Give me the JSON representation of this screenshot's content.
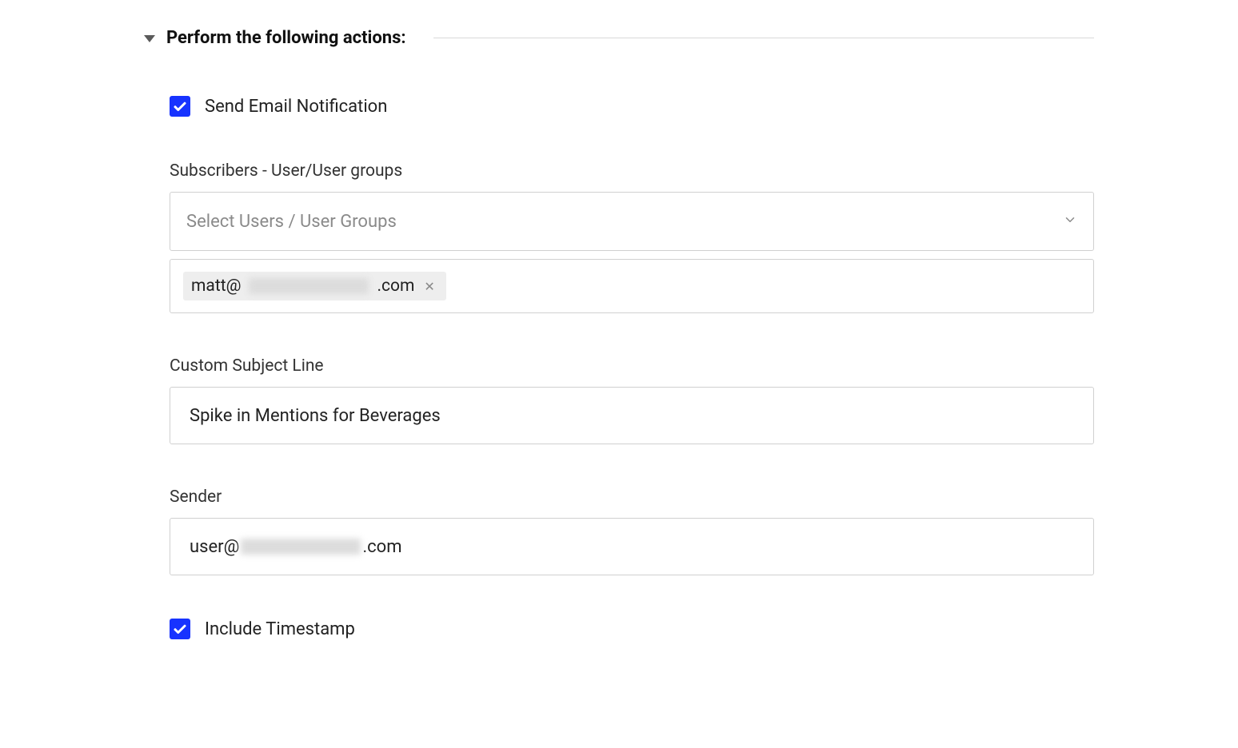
{
  "section": {
    "title": "Perform the following actions:"
  },
  "send_email": {
    "label": "Send Email Notification",
    "checked": true
  },
  "subscribers": {
    "label": "Subscribers - User/User groups",
    "select_placeholder": "Select Users / User Groups",
    "chips": [
      {
        "prefix": "matt@",
        "suffix": ".com",
        "obscured": true
      }
    ]
  },
  "custom_subject": {
    "label": "Custom Subject Line",
    "value": "Spike in Mentions for Beverages"
  },
  "sender": {
    "label": "Sender",
    "prefix": "user@",
    "suffix": ".com",
    "obscured": true
  },
  "include_timestamp": {
    "label": "Include Timestamp",
    "checked": true
  }
}
